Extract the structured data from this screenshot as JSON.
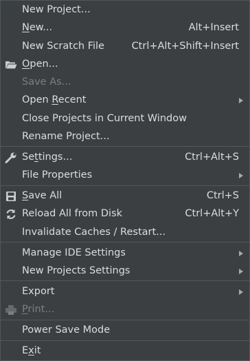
{
  "menu": {
    "items": [
      {
        "id": "new-project",
        "label": "New Project...",
        "shortcut": "",
        "submenu": false,
        "disabled": false,
        "icon": null
      },
      {
        "id": "new",
        "label": "New...",
        "mnemonic_prefix": "",
        "mnemonic_char": "N",
        "mnemonic_rest": "ew...",
        "shortcut": "Alt+Insert",
        "submenu": false,
        "disabled": false,
        "icon": null
      },
      {
        "id": "new-scratch-file",
        "label": "New Scratch File",
        "shortcut": "Ctrl+Alt+Shift+Insert",
        "submenu": false,
        "disabled": false,
        "icon": null
      },
      {
        "id": "open",
        "label": "Open...",
        "mnemonic_prefix": "",
        "mnemonic_char": "O",
        "mnemonic_rest": "pen...",
        "shortcut": "",
        "submenu": false,
        "disabled": false,
        "icon": "folder-open-icon"
      },
      {
        "id": "save-as",
        "label": "Save As...",
        "shortcut": "",
        "submenu": false,
        "disabled": true,
        "icon": null
      },
      {
        "id": "open-recent",
        "label": "Open Recent",
        "mnemonic_prefix": "Open ",
        "mnemonic_char": "R",
        "mnemonic_rest": "ecent",
        "shortcut": "",
        "submenu": true,
        "disabled": false,
        "icon": null
      },
      {
        "id": "close-projects",
        "label": "Close Projects in Current Window",
        "shortcut": "",
        "submenu": false,
        "disabled": false,
        "icon": null
      },
      {
        "id": "rename-project",
        "label": "Rename Project...",
        "shortcut": "",
        "submenu": false,
        "disabled": false,
        "icon": null
      },
      {
        "id": "settings",
        "label": "Settings...",
        "mnemonic_prefix": "Se",
        "mnemonic_char": "t",
        "mnemonic_rest": "tings...",
        "shortcut": "Ctrl+Alt+S",
        "submenu": false,
        "disabled": false,
        "icon": "wrench-icon"
      },
      {
        "id": "file-properties",
        "label": "File Properties",
        "shortcut": "",
        "submenu": true,
        "disabled": false,
        "icon": null
      },
      {
        "id": "save-all",
        "label": "Save All",
        "mnemonic_prefix": "",
        "mnemonic_char": "S",
        "mnemonic_rest": "ave All",
        "shortcut": "Ctrl+S",
        "submenu": false,
        "disabled": false,
        "icon": "floppy-disk-icon"
      },
      {
        "id": "reload-all",
        "label": "Reload All from Disk",
        "shortcut": "Ctrl+Alt+Y",
        "submenu": false,
        "disabled": false,
        "icon": "reload-icon"
      },
      {
        "id": "invalidate-caches",
        "label": "Invalidate Caches / Restart...",
        "shortcut": "",
        "submenu": false,
        "disabled": false,
        "icon": null
      },
      {
        "id": "manage-ide-settings",
        "label": "Manage IDE Settings",
        "shortcut": "",
        "submenu": true,
        "disabled": false,
        "icon": null
      },
      {
        "id": "new-projects-settings",
        "label": "New Projects Settings",
        "shortcut": "",
        "submenu": true,
        "disabled": false,
        "icon": null
      },
      {
        "id": "export",
        "label": "Export",
        "shortcut": "",
        "submenu": true,
        "disabled": false,
        "icon": null
      },
      {
        "id": "print",
        "label": "Print...",
        "mnemonic_prefix": "",
        "mnemonic_char": "P",
        "mnemonic_rest": "rint...",
        "shortcut": "",
        "submenu": false,
        "disabled": true,
        "icon": "printer-icon"
      },
      {
        "id": "power-save-mode",
        "label": "Power Save Mode",
        "shortcut": "",
        "submenu": false,
        "disabled": false,
        "icon": null
      },
      {
        "id": "exit",
        "label": "Exit",
        "mnemonic_prefix": "E",
        "mnemonic_char": "x",
        "mnemonic_rest": "it",
        "shortcut": "",
        "submenu": false,
        "disabled": false,
        "icon": null
      }
    ]
  },
  "colors": {
    "background": "#3c3f41",
    "text": "#dcdcdc",
    "disabled_text": "#7c7f82",
    "separator": "#55585b"
  }
}
